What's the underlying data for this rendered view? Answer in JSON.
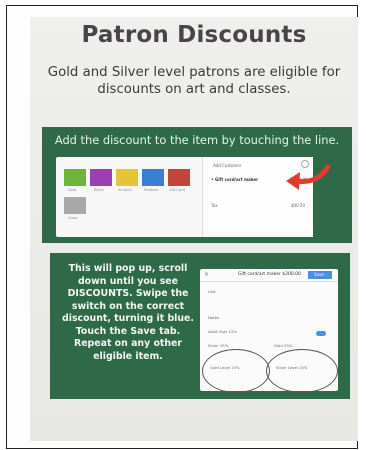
{
  "sign": {
    "title": "Patron Discounts",
    "subtitle_line1": "Gold and Silver level patrons are eligible for",
    "subtitle_line2": "discounts on art and classes."
  },
  "panel_top": {
    "caption": "Add the discount to the item by touching the line.",
    "screen": {
      "tiles": [
        {
          "label": "Gold",
          "color": "#6fb33a"
        },
        {
          "label": "Silver",
          "color": "#9b3fb0"
        },
        {
          "label": "Scratch",
          "color": "#e3c53b"
        },
        {
          "label": "Stickers",
          "color": "#3b7fd1"
        },
        {
          "label": "Gift Card",
          "color": "#c0453a"
        },
        {
          "label": "Class",
          "color": "#a9a9a9"
        }
      ],
      "sidepanel_title": "Add Customer",
      "line_item": "• Gift card/art maker",
      "line_price": "$200.00",
      "tax_label": "Tax",
      "tax_value": "$00.50"
    },
    "arrow_color": "#e23b2e"
  },
  "panel_bottom": {
    "instructions": [
      "This will pop up, scroll",
      "down until you see",
      "DISCOUNTS. Swipe the",
      "switch on the correct",
      "discount, turning it blue.",
      "Touch the Save tab.",
      "Repeat on any other",
      "eligible item."
    ],
    "screen": {
      "header": "Gift card/art maker  $200.00",
      "save_label": "Save",
      "rows": [
        "Unit",
        "Notes",
        "Adult Sale 15%",
        "Silver 15%",
        "Gold 25%"
      ],
      "circle_left_label": "Gold Level 15%",
      "circle_right_label": "Silver Level 15%"
    }
  },
  "colors": {
    "panel_green": "#2f6a48",
    "title_color": "#4a4448",
    "toggle_blue": "#4a90e2"
  }
}
